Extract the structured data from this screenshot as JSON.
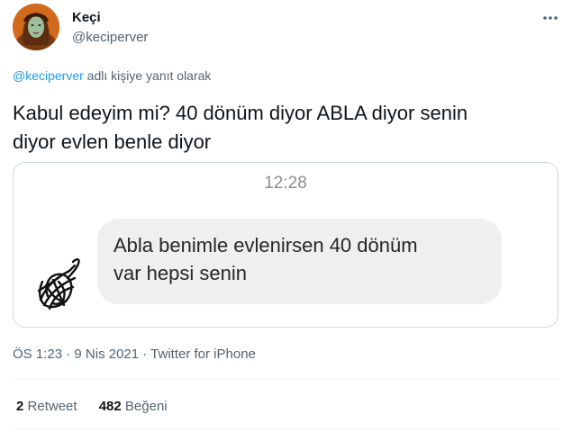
{
  "author": {
    "name": "Keçi",
    "handle": "@keciperver",
    "avatar_icon": "avatar-photo-icon"
  },
  "reply": {
    "mention": "@keciperver",
    "suffix": " adlı kişiye yanıt olarak"
  },
  "tweet": {
    "line1": "Kabul edeyim mi? 40 dönüm diyor ABLA diyor senin",
    "line2": "diyor evlen benle diyor"
  },
  "media": {
    "time": "12:28",
    "message_line1": "Abla benimle evlenirsen 40 dönüm",
    "message_line2": "var hepsi senin"
  },
  "meta": {
    "time": "ÖS 1:23",
    "separator": " · ",
    "date": "9 Nis 2021",
    "source": "Twitter for iPhone"
  },
  "stats": {
    "retweets_count": "2",
    "retweets_label": "Retweet",
    "likes_count": "482",
    "likes_label": "Beğeni"
  },
  "colors": {
    "link": "#1d9bf0",
    "secondary_text": "#536471",
    "bubble": "#efefef"
  }
}
